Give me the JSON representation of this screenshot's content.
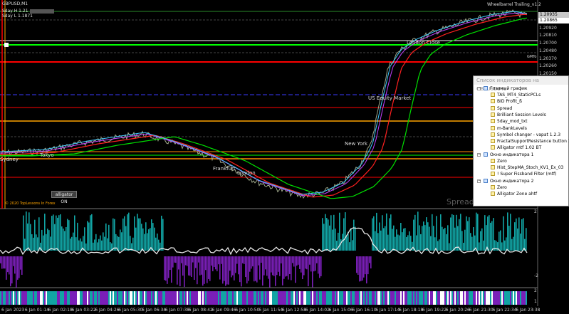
{
  "chart": {
    "symbol_title": "GBPUSD,M1",
    "ea_title": "Wheelbarrel Trailing_v1.2",
    "copyright": "© 2020 TopLessons In Forex",
    "info_lines": [
      "Sday H 1.21",
      "Sday L 1.1871"
    ],
    "alligator_button": "alligator ON",
    "spread_watermark": "Spread",
    "session_labels": {
      "sydney": "Sydney",
      "tokyo": "Tokyo",
      "frankfurt": "Frankfurt",
      "london": "London",
      "new_york": "New York",
      "us_equity": "US Equity Market",
      "london_close": "London Close",
      "gmt": "GMTo"
    },
    "price_labels": [
      "1.20920",
      "1.20810",
      "1.20700",
      "1.20480",
      "1.20370",
      "1.20260",
      "1.20150"
    ],
    "tags": [
      {
        "text": "1.20935",
        "bg": "#c8c8c8",
        "fg": "#000000"
      },
      {
        "text": "1.20865",
        "bg": "#ffffff",
        "fg": "#000000"
      }
    ],
    "subwindow_scale": {
      "sub1_top": "2",
      "sub1_bottom": "-2",
      "sub2_top": "2",
      "sub2_bottom": "1"
    },
    "time_labels": [
      "6 Jan 2023",
      "6 Jan 01:14",
      "6 Jan 02:18",
      "6 Jan 03:22",
      "6 Jan 04:26",
      "6 Jan 05:30",
      "6 Jan 06:34",
      "6 Jan 07:38",
      "6 Jan 08:42",
      "6 Jan 09:46",
      "6 Jan 10:50",
      "6 Jan 11:54",
      "6 Jan 12:58",
      "6 Jan 14:02",
      "6 Jan 15:06",
      "6 Jan 16:10",
      "6 Jan 17:14",
      "6 Jan 18:18",
      "6 Jan 19:22",
      "6 Jan 20:26",
      "6 Jan 21:30",
      "6 Jan 22:34",
      "6 Jan 23:38"
    ]
  },
  "indicator_list": {
    "title": "Список индикаторов на GBPUSD,M1",
    "windows": [
      {
        "name": "Главный график",
        "items": [
          "TAS_MT4_StaticPCLs",
          "BID Profit_ß",
          "Spread",
          "Brilliant Session Levels",
          "5day_mod_txt",
          "m-BankLevels",
          "Symbol changer - vapat 1.2.3",
          "FractalSupportResistance button 1.05",
          "Alligator mtf 1.02 BT"
        ]
      },
      {
        "name": "Окно индикатора 1",
        "items": [
          "Zero",
          "Hist_StepMA_Stoch_KV1_Ex_03",
          "! Super Fissband Filter (mtf)"
        ]
      },
      {
        "name": "Окно индикатора 2",
        "items": [
          "Zero",
          "Alligator Zone ahtf"
        ]
      }
    ]
  },
  "colors": {
    "background": "#000000",
    "red_line": "#ff0000",
    "lime_line": "#00ff00",
    "orange_line": "#ffa500",
    "blue_line": "#3a3aff",
    "teal_hist": "#12a4a4",
    "purple_hist": "#7a1fb8"
  }
}
